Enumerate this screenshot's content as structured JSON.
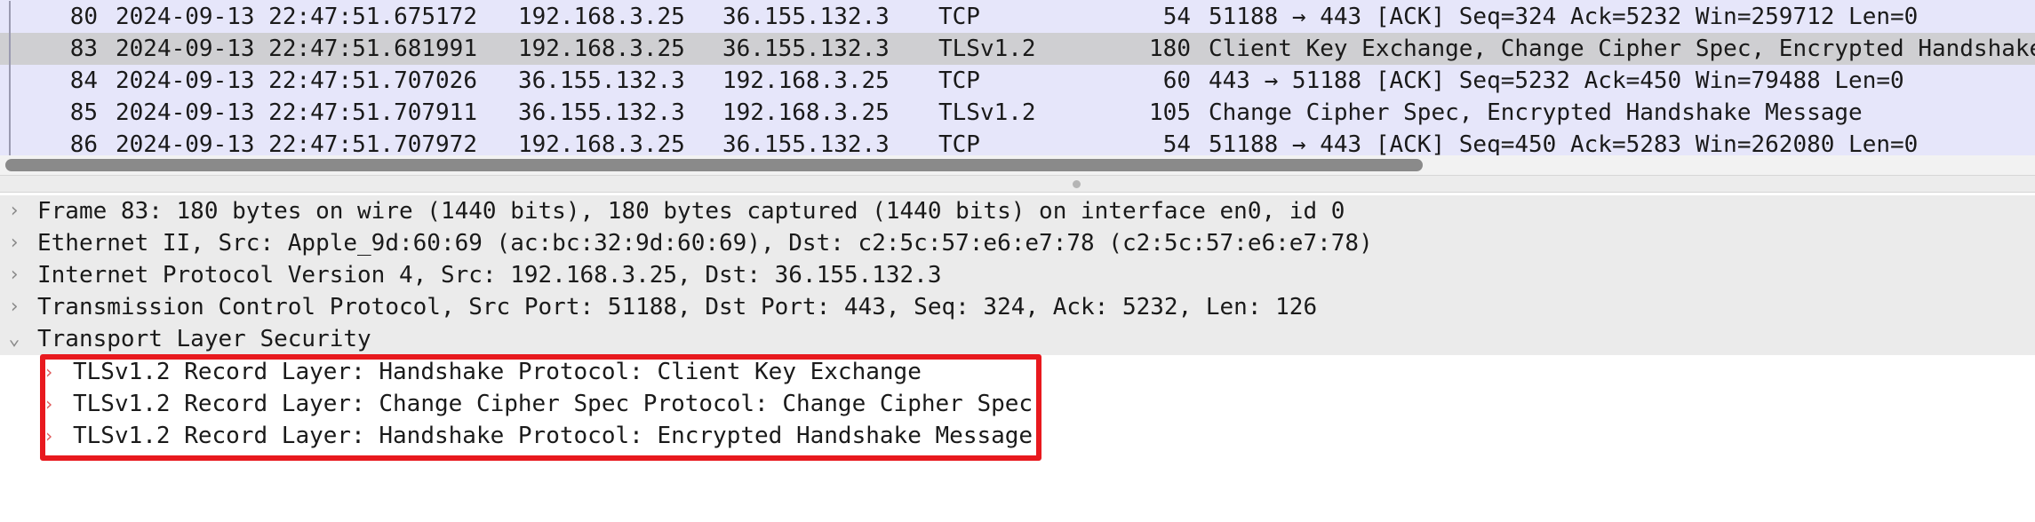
{
  "packets": [
    {
      "no": "80",
      "time": "2024-09-13 22:47:51.675172",
      "src": "192.168.3.25",
      "dst": "36.155.132.3",
      "proto": "TCP",
      "len": "54",
      "info": "51188 → 443 [ACK] Seq=324 Ack=5232 Win=259712 Len=0",
      "selected": false
    },
    {
      "no": "83",
      "time": "2024-09-13 22:47:51.681991",
      "src": "192.168.3.25",
      "dst": "36.155.132.3",
      "proto": "TLSv1.2",
      "len": "180",
      "info": "Client Key Exchange, Change Cipher Spec, Encrypted Handshake",
      "selected": true
    },
    {
      "no": "84",
      "time": "2024-09-13 22:47:51.707026",
      "src": "36.155.132.3",
      "dst": "192.168.3.25",
      "proto": "TCP",
      "len": "60",
      "info": "443 → 51188 [ACK] Seq=5232 Ack=450 Win=79488 Len=0",
      "selected": false
    },
    {
      "no": "85",
      "time": "2024-09-13 22:47:51.707911",
      "src": "36.155.132.3",
      "dst": "192.168.3.25",
      "proto": "TLSv1.2",
      "len": "105",
      "info": "Change Cipher Spec, Encrypted Handshake Message",
      "selected": false
    },
    {
      "no": "86",
      "time": "2024-09-13 22:47:51.707972",
      "src": "192.168.3.25",
      "dst": "36.155.132.3",
      "proto": "TCP",
      "len": "54",
      "info": "51188 → 443 [ACK] Seq=450 Ack=5283 Win=262080 Len=0",
      "selected": false
    }
  ],
  "details": [
    {
      "text": "Frame 83: 180 bytes on wire (1440 bits), 180 bytes captured (1440 bits) on interface en0, id 0",
      "expanded": false
    },
    {
      "text": "Ethernet II, Src: Apple_9d:60:69 (ac:bc:32:9d:60:69), Dst: c2:5c:57:e6:e7:78 (c2:5c:57:e6:e7:78)",
      "expanded": false
    },
    {
      "text": "Internet Protocol Version 4, Src: 192.168.3.25, Dst: 36.155.132.3",
      "expanded": false
    },
    {
      "text": "Transmission Control Protocol, Src Port: 51188, Dst Port: 443, Seq: 324, Ack: 5232, Len: 126",
      "expanded": false
    },
    {
      "text": "Transport Layer Security",
      "expanded": true
    }
  ],
  "tls_records": [
    "TLSv1.2 Record Layer: Handshake Protocol: Client Key Exchange",
    "TLSv1.2 Record Layer: Change Cipher Spec Protocol: Change Cipher Spec",
    "TLSv1.2 Record Layer: Handshake Protocol: Encrypted Handshake Message"
  ],
  "icons": {
    "collapsed": "chevron-right-icon",
    "expanded": "chevron-down-icon"
  },
  "colors": {
    "packet_bg": "#e6e6fa",
    "selected_bg": "#cfcfd2",
    "highlight": "#e8191e"
  }
}
